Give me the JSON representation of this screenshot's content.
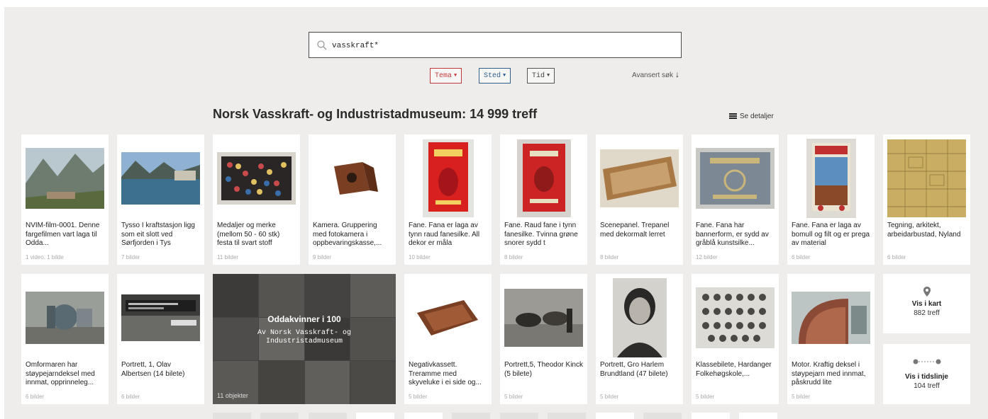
{
  "search": {
    "value": "vasskraft*"
  },
  "filters": [
    {
      "label": "Tema",
      "color": "#c13a3a"
    },
    {
      "label": "Sted",
      "color": "#2f5f8a"
    },
    {
      "label": "Tid",
      "color": "#555555"
    }
  ],
  "advanced_search": "Avansert søk",
  "results_title": "Norsk Vasskraft- og Industristadmuseum: 14 999 treff",
  "details_label": "Se detaljer",
  "row1": [
    {
      "desc": "NVIM-film-0001. Denne fargefilmen vart laga til Odda...",
      "count": "1 video, 1 bilde"
    },
    {
      "desc": "Tysso I kraftstasjon ligg som eit slott ved Sørfjorden i Tys",
      "count": "7 bilder"
    },
    {
      "desc": "Medaljer og merke (mellom 50 - 60 stk) festa til svart stoff",
      "count": "11 bilder"
    },
    {
      "desc": "Kamera. Gruppering med fotokamera i oppbevaringskasse,...",
      "count": "9 bilder"
    },
    {
      "desc": "Fane. Fana er laga av tynn raud fanesilke. All dekor er måla",
      "count": "10 bilder"
    },
    {
      "desc": "Fane. Raud fane i tynn fanesilke. Tvinna grøne snorer sydd t",
      "count": "8 bilder"
    },
    {
      "desc": "Scenepanel. Trepanel med dekormalt lerret",
      "count": "8 bilder"
    },
    {
      "desc": "Fane. Fana har bannerform, er sydd av gråblå kunstsilke...",
      "count": "12 bilder"
    },
    {
      "desc": "Fane. Fana er laga av bomull og filt og er prega av material",
      "count": "6 bilder"
    },
    {
      "desc": "Tegning, arkitekt, arbeidarbustad, Nyland",
      "count": "6 bilder"
    }
  ],
  "row2_left": [
    {
      "desc": "Omformaren har støypejarndeksel med innmat, opprinneleg...",
      "count": "6 bilder"
    },
    {
      "desc": "Portrett, 1, Olav Albertsen (14 bilete)",
      "count": "6 bilder"
    }
  ],
  "feature": {
    "title": "Oddakvinner i 100",
    "subtitle": "Av Norsk Vasskraft- og Industristadmuseum",
    "count": "11 objekter"
  },
  "row2_right": [
    {
      "desc": "Negativkassett. Treramme med skyveluke i ei side og...",
      "count": "5 bilder"
    },
    {
      "desc": "Portrett,5, Theodor Kinck (5 bilete)",
      "count": "5 bilder"
    },
    {
      "desc": "Portrett, Gro Harlem Brundtland (47 bilete)",
      "count": "5 bilder"
    },
    {
      "desc": "Klassebilete, Hardanger Folkehøgskole,...",
      "count": "5 bilder"
    },
    {
      "desc": "Motor. Kraftig deksel i støypejarn med innmat, påskrudd lite",
      "count": "5 bilder"
    }
  ],
  "map": {
    "label": "Vis i kart",
    "count": "882 treff"
  },
  "timeline": {
    "label": "Vis i tidslinje",
    "count": "104 treff"
  }
}
